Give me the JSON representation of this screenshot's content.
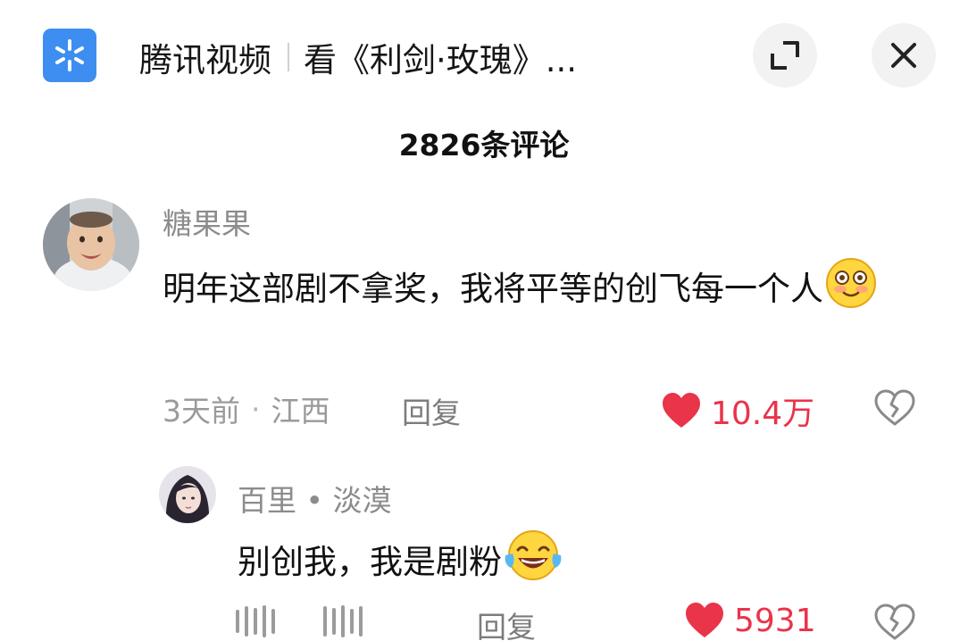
{
  "header": {
    "app_icon": "tencent-video-logo",
    "app_name": "腾讯视频",
    "title": "看《利剑·玫瑰》...",
    "expand_icon": "expand-icon",
    "close_icon": "close-icon"
  },
  "comments_header": {
    "count_label": "2826条评论"
  },
  "comments": [
    {
      "username": "糖果果",
      "text": "明年这部剧不拿奖，我将平等的创飞每一个人",
      "emoji": "blushing-smile-emoji",
      "time": "3天前",
      "location": "江西",
      "reply_label": "回复",
      "likes": "10.4万",
      "like_icon": "heart-icon",
      "dislike_icon": "broken-heart-icon",
      "liked": true
    },
    {
      "username": "百里 • 淡漠",
      "text": "别创我，我是剧粉",
      "emoji": "tears-of-joy-emoji",
      "reply_label": "回复",
      "likes": "5931",
      "like_icon": "heart-icon",
      "dislike_icon": "broken-heart-icon",
      "liked": true
    }
  ],
  "colors": {
    "like": "#e9344a",
    "app_icon_bg": "#3d8ef0",
    "muted_text": "#8c8c8c"
  }
}
